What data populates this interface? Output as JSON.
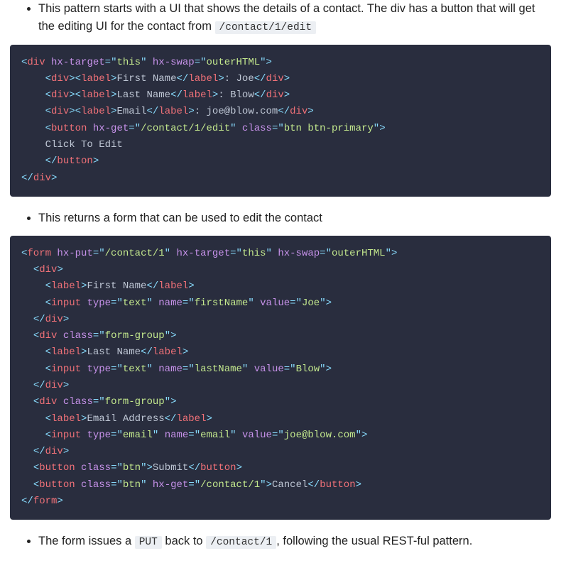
{
  "bullets": {
    "b1a": "This pattern starts with a UI that shows the details of a contact. The div has a button that will get the editing UI for the contact from ",
    "b1_code": "/contact/1/edit",
    "b2": "This returns a form that can be used to edit the contact",
    "b3a": "The form issues a ",
    "b3_code1": "PUT",
    "b3b": " back to ",
    "b3_code2": "/contact/1",
    "b3c": ", following the usual REST-ful pattern."
  },
  "code1": {
    "l1": {
      "tag": "div",
      "attrs": [
        [
          "hx-target",
          "this"
        ],
        [
          "hx-swap",
          "outerHTML"
        ]
      ]
    },
    "l2": {
      "indent": "    ",
      "open": "div",
      "label": "First Name",
      "after_label": ": Joe",
      "close": "div"
    },
    "l3": {
      "indent": "    ",
      "open": "div",
      "label": "Last Name",
      "after_label": ": Blow",
      "close": "div"
    },
    "l4": {
      "indent": "    ",
      "open": "div",
      "label": "Email",
      "after_label": ": joe@blow.com",
      "close": "div"
    },
    "l5": {
      "indent": "    ",
      "tag": "button",
      "attrs": [
        [
          "hx-get",
          "/contact/1/edit"
        ],
        [
          "class",
          "btn btn-primary"
        ]
      ]
    },
    "l6": {
      "indent": "    ",
      "text": "Click To Edit"
    },
    "l7": {
      "indent": "    ",
      "close": "button"
    },
    "l8": {
      "close": "div"
    }
  },
  "code2": {
    "l1": {
      "tag": "form",
      "attrs": [
        [
          "hx-put",
          "/contact/1"
        ],
        [
          "hx-target",
          "this"
        ],
        [
          "hx-swap",
          "outerHTML"
        ]
      ]
    },
    "l2": {
      "indent": "  ",
      "open_simple": "div"
    },
    "l3": {
      "indent": "    ",
      "label_full": "First Name"
    },
    "l4": {
      "indent": "    ",
      "self": "input",
      "attrs": [
        [
          "type",
          "text"
        ],
        [
          "name",
          "firstName"
        ],
        [
          "value",
          "Joe"
        ]
      ]
    },
    "l5": {
      "indent": "  ",
      "close": "div"
    },
    "l6": {
      "indent": "  ",
      "tag": "div",
      "attrs": [
        [
          "class",
          "form-group"
        ]
      ]
    },
    "l7": {
      "indent": "    ",
      "label_full": "Last Name"
    },
    "l8": {
      "indent": "    ",
      "self": "input",
      "attrs": [
        [
          "type",
          "text"
        ],
        [
          "name",
          "lastName"
        ],
        [
          "value",
          "Blow"
        ]
      ]
    },
    "l9": {
      "indent": "  ",
      "close": "div"
    },
    "l10": {
      "indent": "  ",
      "tag": "div",
      "attrs": [
        [
          "class",
          "form-group"
        ]
      ]
    },
    "l11": {
      "indent": "    ",
      "label_full": "Email Address"
    },
    "l12": {
      "indent": "    ",
      "self": "input",
      "attrs": [
        [
          "type",
          "email"
        ],
        [
          "name",
          "email"
        ],
        [
          "value",
          "joe@blow.com"
        ]
      ]
    },
    "l13": {
      "indent": "  ",
      "close": "div"
    },
    "l14": {
      "indent": "  ",
      "tag_inline": "button",
      "attrs": [
        [
          "class",
          "btn"
        ]
      ],
      "inner": "Submit"
    },
    "l15": {
      "indent": "  ",
      "tag_inline": "button",
      "attrs": [
        [
          "class",
          "btn"
        ],
        [
          "hx-get",
          "/contact/1"
        ]
      ],
      "inner": "Cancel"
    },
    "l16": {
      "close": "form"
    }
  }
}
